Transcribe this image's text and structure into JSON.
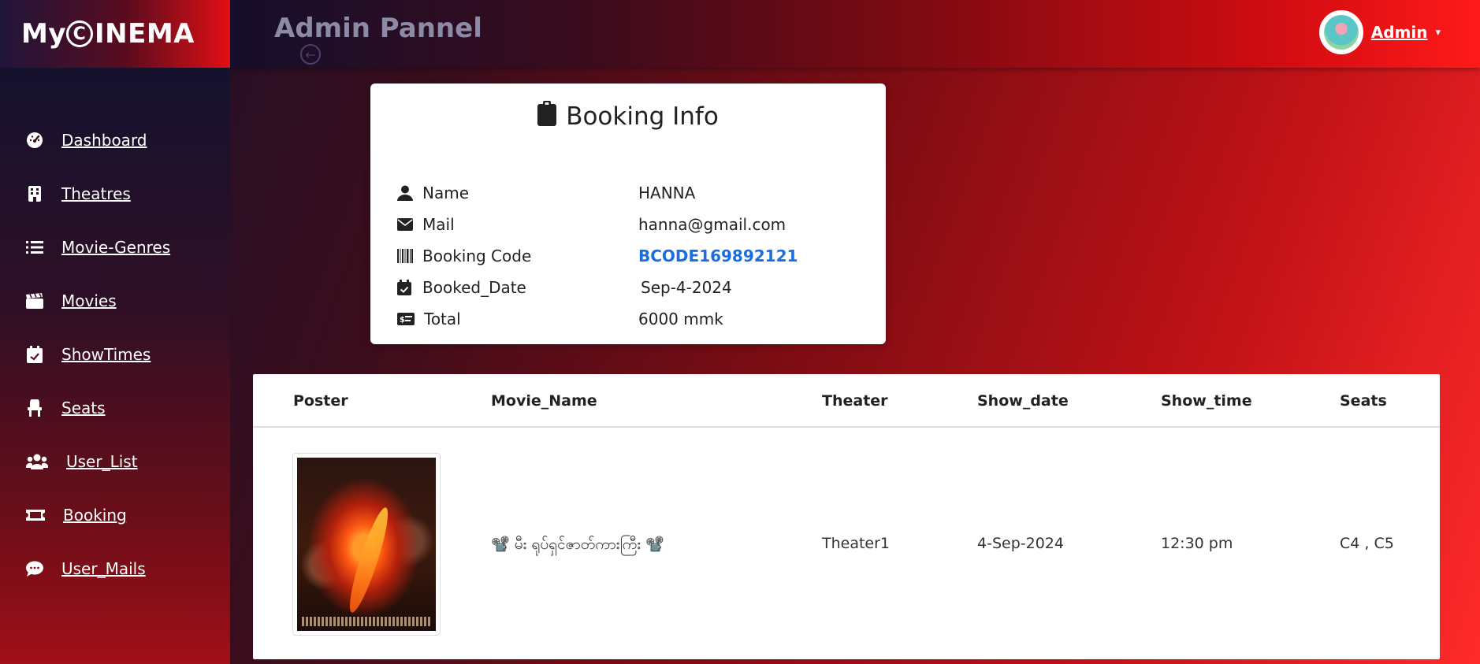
{
  "header": {
    "logo_prefix": "My",
    "logo_mark": "C",
    "logo_suffix": "INEMA",
    "title": "Admin Pannel",
    "user_label": "Admin"
  },
  "sidebar": {
    "items": [
      {
        "label": "Dashboard",
        "icon": "gauge-icon"
      },
      {
        "label": "Theatres",
        "icon": "building-icon"
      },
      {
        "label": "Movie-Genres",
        "icon": "list-icon"
      },
      {
        "label": "Movies",
        "icon": "clapperboard-icon"
      },
      {
        "label": "ShowTimes",
        "icon": "calendar-check-icon"
      },
      {
        "label": "Seats",
        "icon": "chair-icon"
      },
      {
        "label": "User_List",
        "icon": "users-icon"
      },
      {
        "label": "Booking",
        "icon": "ticket-icon"
      },
      {
        "label": "User_Mails",
        "icon": "comment-icon"
      }
    ]
  },
  "booking_info": {
    "title": "Booking Info",
    "rows": [
      {
        "key": "Name",
        "value": "HANNA"
      },
      {
        "key": "Mail",
        "value": "hanna@gmail.com"
      },
      {
        "key": "Booking Code",
        "value": "BCODE169892121"
      },
      {
        "key": "Booked_Date",
        "value": "Sep-4-2024"
      },
      {
        "key": "Total",
        "value": "6000 mmk"
      }
    ]
  },
  "table": {
    "headers": [
      "Poster",
      "Movie_Name",
      "Theater",
      "Show_date",
      "Show_time",
      "Seats"
    ],
    "rows": [
      {
        "movie_name": "📽️ မီး ရုပ်ရှင်ဇာတ်ကားကြီး 📽️",
        "theater": "Theater1",
        "show_date": "4-Sep-2024",
        "show_time": "12:30 pm",
        "seats": "C4 , C5"
      }
    ]
  },
  "colors": {
    "accent_link": "#1a6fe0",
    "brand_red": "#e30f14",
    "dark_navy": "#15122e"
  }
}
